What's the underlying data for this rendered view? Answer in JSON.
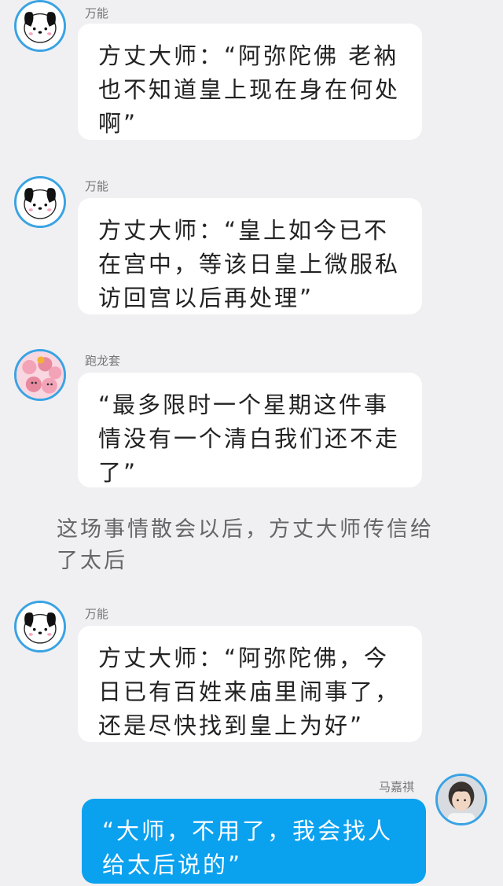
{
  "messages": [
    {
      "sender": "万能",
      "avatar": "pochacco-dog-icon",
      "text": "方丈大师：“阿弥陀佛 老衲也不知道皇上现在身在何处啊”"
    },
    {
      "sender": "万能",
      "avatar": "pochacco-dog-icon",
      "text": "方丈大师：“皇上如今已不在宫中，等该日皇上微服私访回宫以后再处理”"
    },
    {
      "sender": "跑龙套",
      "avatar": "pink-bears-icon",
      "text": "“最多限时一个星期这件事情没有一个清白我们还不走了”"
    }
  ],
  "narration": "这场事情散会以后，方丈大师传信给了太后",
  "messages2": [
    {
      "sender": "万能",
      "avatar": "pochacco-dog-icon",
      "text": "方丈大师：“阿弥陀佛，今日已有百姓来庙里闹事了，还是尽快找到皇上为好”"
    },
    {
      "sender": "马嘉祺",
      "avatar": "person-photo-icon",
      "text": "“大师，不用了，我会找人给太后说的”"
    }
  ],
  "colors": {
    "background": "#f0f0f3",
    "bubble_left": "#ffffff",
    "bubble_right": "#0aa1ef",
    "avatar_border": "#3aa3e3"
  }
}
